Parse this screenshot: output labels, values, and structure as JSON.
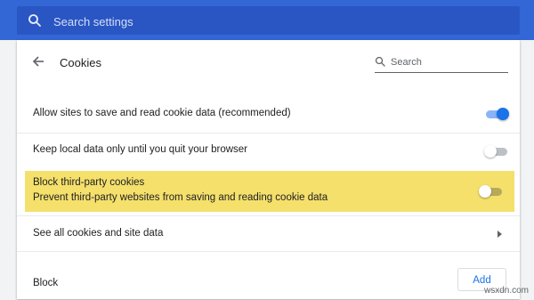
{
  "top_search": {
    "placeholder": "Search settings",
    "icon": "search-icon"
  },
  "page": {
    "title": "Cookies",
    "search_placeholder": "Search"
  },
  "settings": [
    {
      "label": "Allow sites to save and read cookie data (recommended)",
      "enabled": true
    },
    {
      "label": "Keep local data only until you quit your browser",
      "enabled": false
    },
    {
      "label": "Block third-party cookies",
      "sublabel": "Prevent third-party websites from saving and reading cookie data",
      "enabled": false,
      "highlighted": true
    }
  ],
  "link_row": {
    "label": "See all cookies and site data"
  },
  "block_section": {
    "label": "Block",
    "add_label": "Add"
  },
  "watermark": "wsxdn.com",
  "colors": {
    "topbar": "#3367d6",
    "accent": "#1a73e8",
    "highlight": "#f5e06b"
  }
}
